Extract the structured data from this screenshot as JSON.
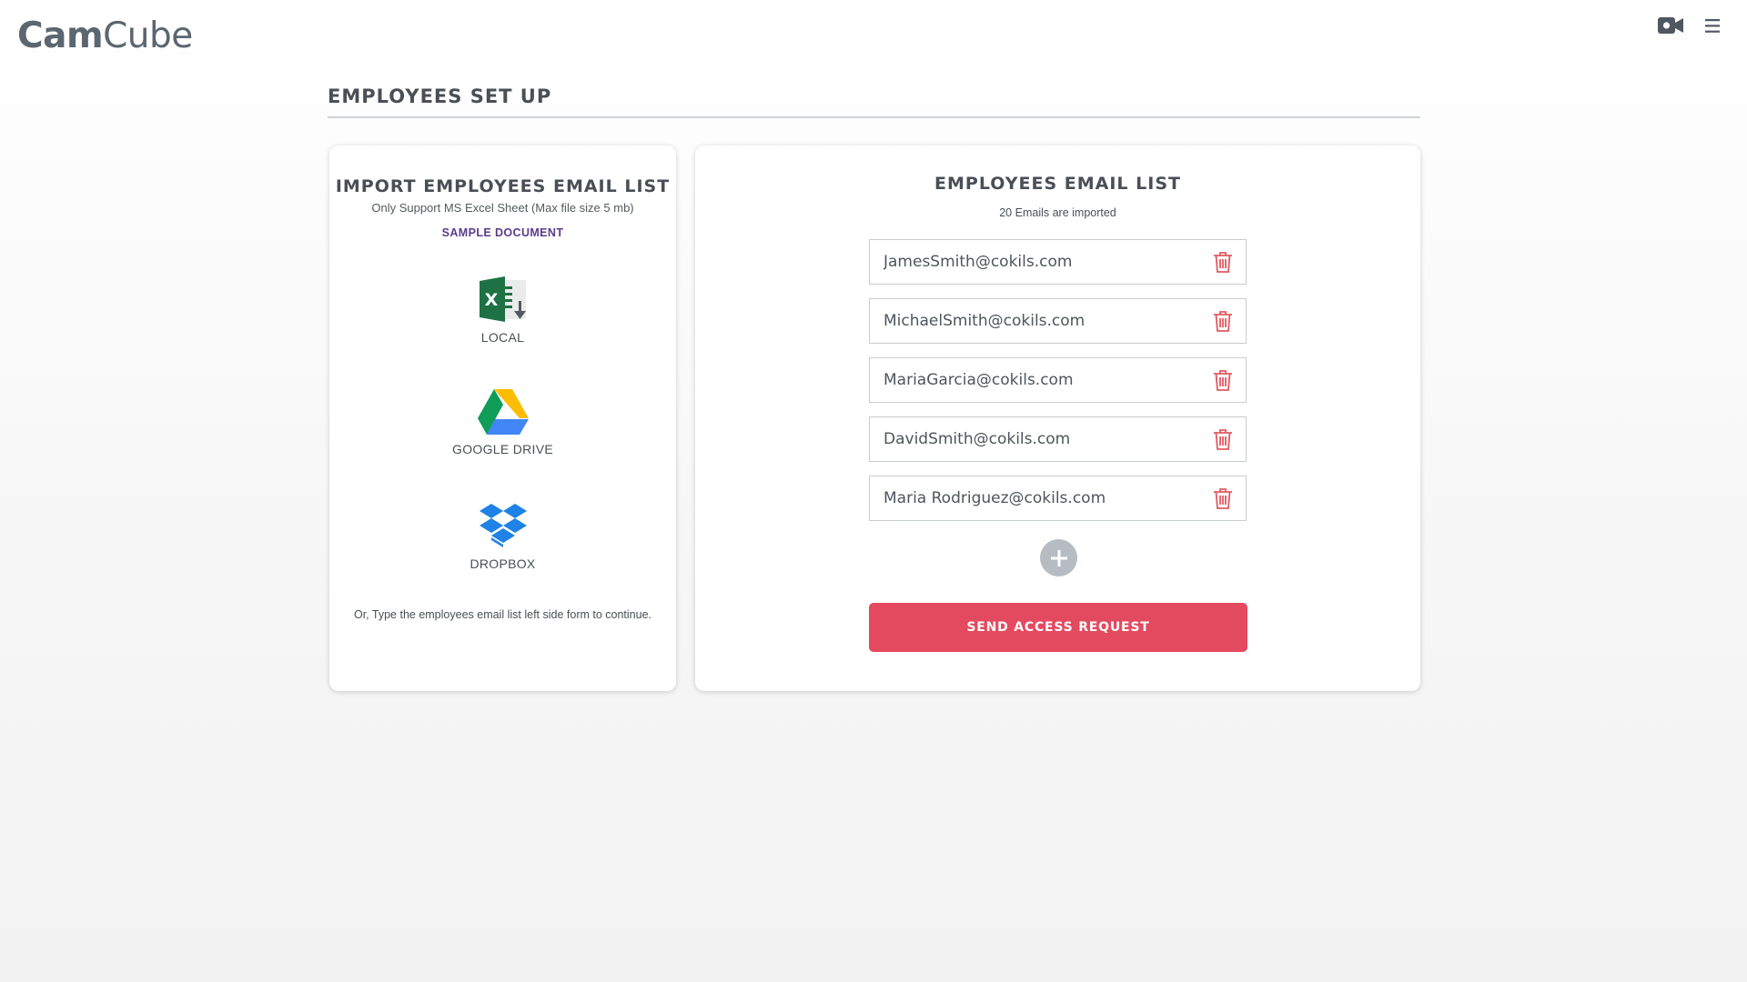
{
  "header": {
    "logo_bold": "Cam",
    "logo_light": "Cube",
    "icons": [
      "video-camera-icon",
      "hamburger-menu-icon"
    ]
  },
  "page": {
    "title": "EMPLOYEES SET UP"
  },
  "import_panel": {
    "title": "IMPORT EMPLOYEES EMAIL LIST",
    "subtitle": "Only Support MS Excel Sheet (Max file size 5 mb)",
    "sample_link": "SAMPLE DOCUMENT",
    "sources": [
      {
        "label": "LOCAL",
        "icon": "excel-download-icon"
      },
      {
        "label": "GOOGLE DRIVE",
        "icon": "google-drive-icon"
      },
      {
        "label": "DROPBOX",
        "icon": "dropbox-icon"
      }
    ],
    "footer": "Or, Type the employees email list left side form to continue."
  },
  "email_panel": {
    "title": "EMPLOYEES EMAIL LIST",
    "subtitle": "20 Emails are imported",
    "emails": [
      "JamesSmith@cokils.com",
      "MichaelSmith@cokils.com",
      "MariaGarcia@cokils.com",
      "DavidSmith@cokils.com",
      "Maria Rodriguez@cokils.com"
    ],
    "send_label": "SEND ACCESS REQUEST"
  },
  "colors": {
    "accent": "#e44a5f",
    "trash": "#e05a60",
    "link": "#5a3d8a",
    "text": "#4a4f56"
  }
}
